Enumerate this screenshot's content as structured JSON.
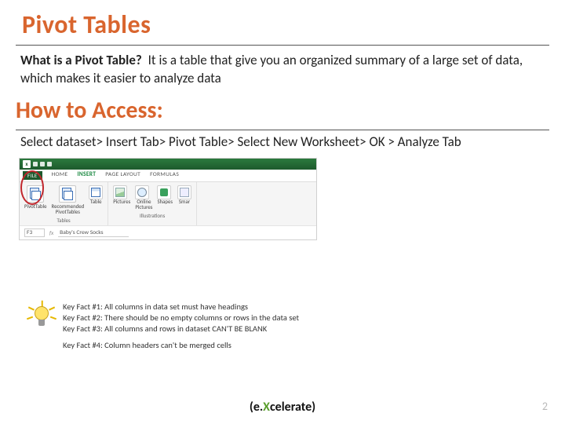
{
  "title": "Pivot Tables",
  "intro": {
    "lead": "What is a Pivot Table?",
    "body": "It is a table that give you an organized summary of a large set of data, which makes it easier to analyze data"
  },
  "how_heading": "How to Access:",
  "path": "Select dataset> Insert Tab> Pivot Table> Select New Worksheet> OK > Analyze Tab",
  "ribbon": {
    "tabs": {
      "file": "FILE",
      "home": "HOME",
      "insert": "INSERT",
      "pagelayout": "PAGE LAYOUT",
      "formulas": "FORMULAS"
    },
    "pivot": {
      "btn1": "PivotTable",
      "btn2": "Recommended\nPivotTables",
      "group": "Tables"
    },
    "table": "Table",
    "illus": {
      "pictures": "Pictures",
      "online": "Online\nPictures",
      "shapes": "Shapes",
      "smart": "Smar",
      "group": "Illustrations"
    },
    "cell": {
      "ref": "F3",
      "fx": "fx",
      "val": "Baby's Crew Socks"
    }
  },
  "key_facts": {
    "f1": "Key Fact #1: All columns in data set must have headings",
    "f2": "Key Fact #2: There should be no empty columns or rows in the data set",
    "f3": "Key Fact #3: All columns and rows in dataset CAN'T BE BLANK",
    "f4": "Key Fact #4: Column headers can't be merged cells"
  },
  "brand": {
    "open": "(e.",
    "x": "X",
    "rest": "celerate)"
  },
  "page_number": "2"
}
